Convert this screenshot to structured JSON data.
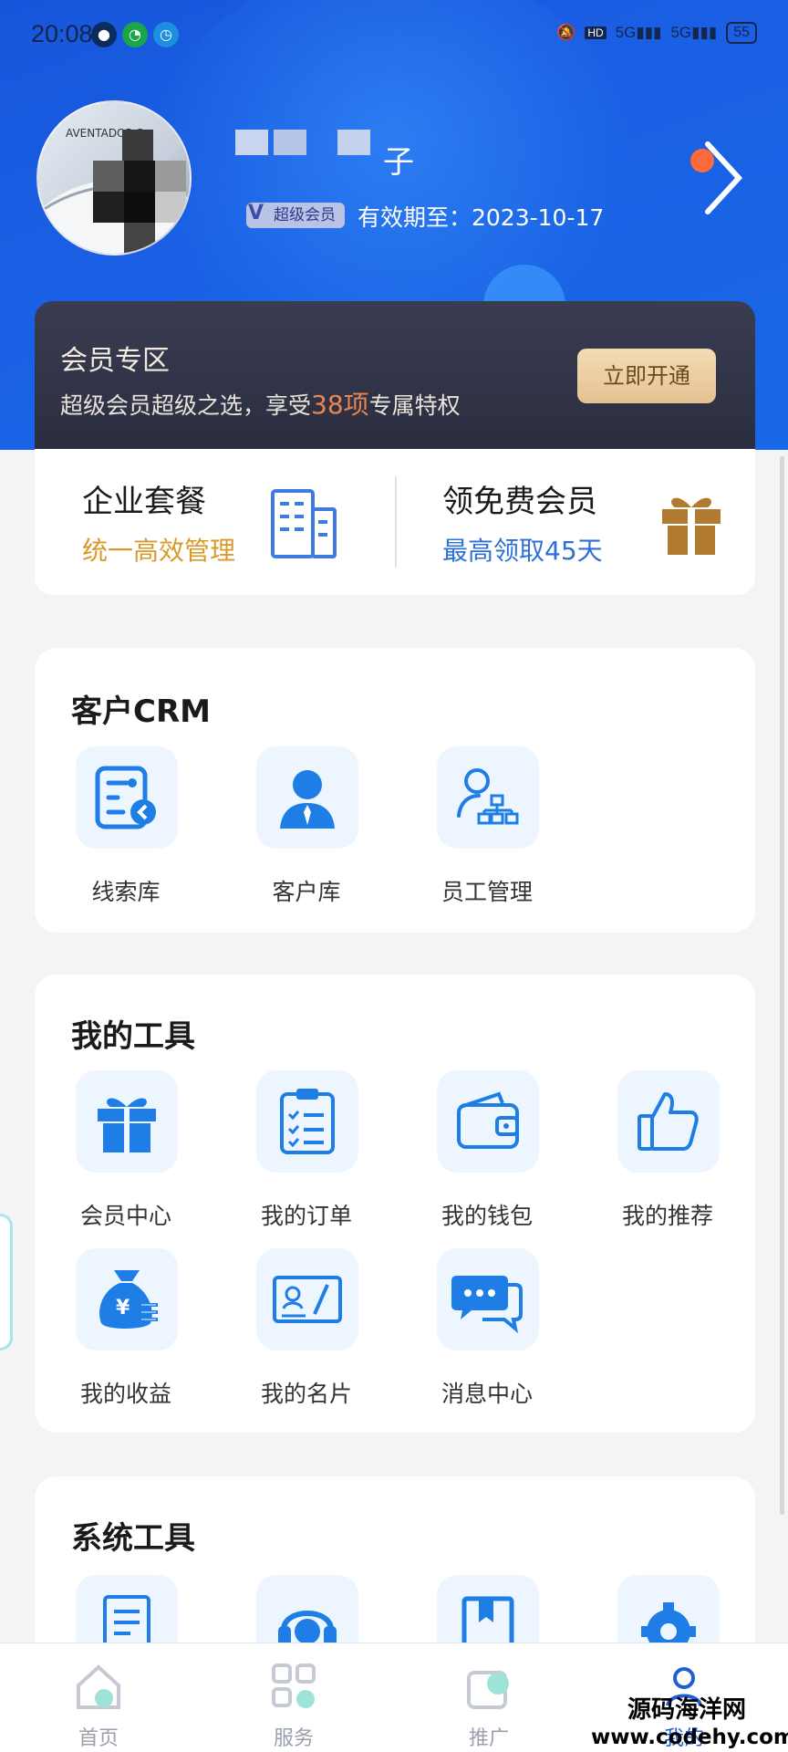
{
  "status_bar": {
    "time": "20:08",
    "network": "5G",
    "network2": "5G",
    "battery": "55"
  },
  "profile": {
    "name_suffix": "子",
    "badge": "超级会员",
    "expire": "有效期至：2023-10-17"
  },
  "vip_zone": {
    "title": "会员专区",
    "subtitle_pre": "超级会员超级之选，享受",
    "highlight": "38项",
    "subtitle_post": "专属特权",
    "button": "立即开通"
  },
  "promo": {
    "left": {
      "title": "企业套餐",
      "subtitle": "统一高效管理"
    },
    "right": {
      "title": "领免费会员",
      "subtitle": "最高领取45天"
    }
  },
  "crm": {
    "title": "客户CRM",
    "items": [
      {
        "label": "线索库",
        "icon": "clue-library-icon"
      },
      {
        "label": "客户库",
        "icon": "customer-icon"
      },
      {
        "label": "员工管理",
        "icon": "org-chart-icon"
      }
    ]
  },
  "tools": {
    "title": "我的工具",
    "items": [
      {
        "label": "会员中心",
        "icon": "gift-icon"
      },
      {
        "label": "我的订单",
        "icon": "clipboard-icon"
      },
      {
        "label": "我的钱包",
        "icon": "wallet-icon"
      },
      {
        "label": "我的推荐",
        "icon": "thumbs-up-icon"
      },
      {
        "label": "我的收益",
        "icon": "money-bag-icon"
      },
      {
        "label": "我的名片",
        "icon": "business-card-icon"
      },
      {
        "label": "消息中心",
        "icon": "chat-icon"
      }
    ]
  },
  "system": {
    "title": "系统工具"
  },
  "bottom_nav": [
    {
      "label": "首页",
      "icon": "home-icon"
    },
    {
      "label": "服务",
      "icon": "grid-icon"
    },
    {
      "label": "推广",
      "icon": "share-icon"
    },
    {
      "label": "我的",
      "icon": "profile-icon"
    }
  ],
  "watermark": {
    "line1": "源码海洋网",
    "line2": "www.codehy.com"
  },
  "colors": {
    "primary": "#1a5fe4",
    "icon_blue": "#1f7ee6",
    "gold": "#d99a2b",
    "accent_orange": "#e9864e"
  }
}
